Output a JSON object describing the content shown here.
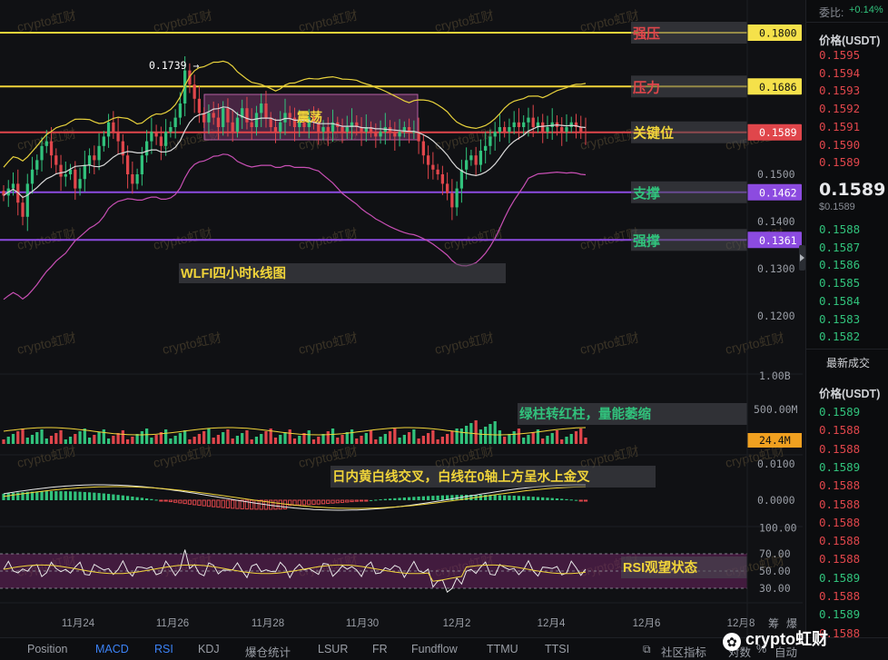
{
  "chart_data": [
    {
      "type": "candlestick",
      "title": "WLFI四小时k线图",
      "y_ticks": [
        "0.1500",
        "0.1400",
        "0.1300",
        "0.1200"
      ],
      "ylim": [
        0.11,
        0.184
      ],
      "x_tick_labels": [
        "11月24",
        "11月26",
        "11月28",
        "11月30",
        "12月2",
        "12月4",
        "12月6",
        "12月8"
      ],
      "high_annotation": "0.1739",
      "range_box_label": "震荡",
      "levels": [
        {
          "label": "强压",
          "value": 0.18,
          "tag": "0.1800",
          "color": "#f0d43a",
          "label_color": "#e0464b"
        },
        {
          "label": "压力",
          "value": 0.1686,
          "tag": "0.1686",
          "color": "#f0d43a",
          "label_color": "#e0464b"
        },
        {
          "label": "关键位",
          "value": 0.1589,
          "tag": "0.1589",
          "color": "#e0464b",
          "label_color": "#f0d43a"
        },
        {
          "label": "支撑",
          "value": 0.1462,
          "tag": "0.1462",
          "color": "#8c4be0",
          "label_color": "#31c27c"
        },
        {
          "label": "强撑",
          "value": 0.1361,
          "tag": "0.1361",
          "color": "#8c4be0",
          "label_color": "#31c27c"
        }
      ],
      "closes": [
        0.1455,
        0.147,
        0.148,
        0.144,
        0.141,
        0.148,
        0.151,
        0.153,
        0.156,
        0.157,
        0.154,
        0.152,
        0.1495,
        0.15,
        0.151,
        0.147,
        0.149,
        0.152,
        0.154,
        0.153,
        0.156,
        0.158,
        0.161,
        0.159,
        0.157,
        0.154,
        0.15,
        0.148,
        0.15,
        0.154,
        0.157,
        0.159,
        0.158,
        0.156,
        0.159,
        0.16,
        0.162,
        0.165,
        0.172,
        0.169,
        0.166,
        0.163,
        0.161,
        0.163,
        0.162,
        0.16,
        0.164,
        0.161,
        0.159,
        0.162,
        0.164,
        0.161,
        0.16,
        0.163,
        0.165,
        0.162,
        0.16,
        0.159,
        0.161,
        0.163,
        0.162,
        0.16,
        0.161,
        0.16,
        0.162,
        0.161,
        0.159,
        0.16,
        0.159,
        0.161,
        0.16,
        0.159,
        0.16,
        0.161,
        0.16,
        0.159,
        0.16,
        0.159,
        0.158,
        0.159,
        0.16,
        0.159,
        0.158,
        0.159,
        0.16,
        0.159,
        0.159,
        0.157,
        0.154,
        0.152,
        0.151,
        0.15,
        0.148,
        0.146,
        0.143,
        0.147,
        0.151,
        0.153,
        0.154,
        0.152,
        0.155,
        0.156,
        0.158,
        0.159,
        0.16,
        0.159,
        0.16,
        0.161,
        0.16,
        0.161,
        0.162,
        0.16,
        0.161,
        0.159,
        0.16,
        0.161,
        0.16,
        0.159,
        0.16,
        0.161,
        0.16,
        0.159,
        0.1589
      ]
    },
    {
      "type": "bar",
      "title": "Volume",
      "y_ticks": [
        "1.00B",
        "500.00M"
      ],
      "current_tag": "24.4M",
      "annotation": "绿柱转红柱，量能萎缩"
    },
    {
      "type": "bar",
      "title": "MACD",
      "y_ticks": [
        "0.0100",
        "0.0000"
      ],
      "annotation": "日内黄白线交叉，白线在0轴上方呈水上金叉"
    },
    {
      "type": "line",
      "title": "RSI",
      "y_ticks": [
        "100.00",
        "70.00",
        "50.00",
        "30.00"
      ],
      "annotation": "RSI观望状态"
    }
  ],
  "watermark": "crypto虹财",
  "orderbook": {
    "ratio_label": "委比:",
    "ratio_value": "+0.14%",
    "price_header": "价格(USDT)",
    "asks": [
      "0.1595",
      "0.1594",
      "0.1593",
      "0.1592",
      "0.1591",
      "0.1590",
      "0.1589"
    ],
    "last_price": "0.1589",
    "last_price_usd": "$0.1589",
    "bids": [
      "0.1588",
      "0.1587",
      "0.1586",
      "0.1585",
      "0.1584",
      "0.1583",
      "0.1582"
    ],
    "recent_trades_title": "最新成交",
    "trades_price_header": "价格(USDT)",
    "trades": [
      {
        "price": "0.1589",
        "side": "buy"
      },
      {
        "price": "0.1588",
        "side": "sell"
      },
      {
        "price": "0.1588",
        "side": "sell"
      },
      {
        "price": "0.1589",
        "side": "buy"
      },
      {
        "price": "0.1588",
        "side": "sell"
      },
      {
        "price": "0.1588",
        "side": "sell"
      },
      {
        "price": "0.1588",
        "side": "sell"
      },
      {
        "price": "0.1588",
        "side": "sell"
      },
      {
        "price": "0.1588",
        "side": "sell"
      },
      {
        "price": "0.1589",
        "side": "buy"
      },
      {
        "price": "0.1588",
        "side": "sell"
      },
      {
        "price": "0.1589",
        "side": "buy"
      },
      {
        "price": "0.1588",
        "side": "sell"
      },
      {
        "price": "0.1588",
        "side": "sell"
      }
    ]
  },
  "bottom_tabs": [
    "Position",
    "MACD",
    "RSI",
    "KDJ",
    "爆仓统计",
    "LSUR",
    "FR",
    "Fundflow",
    "TTMU",
    "TTSI"
  ],
  "bottom_active_tabs": [
    "MACD",
    "RSI"
  ],
  "bottom_right": {
    "community_label": "社区指标",
    "log_label": "对数",
    "percent_label": "%",
    "auto_label": "自动",
    "extra_label": "筹",
    "extra2_label": "爆"
  },
  "brand": "crypto虹财"
}
